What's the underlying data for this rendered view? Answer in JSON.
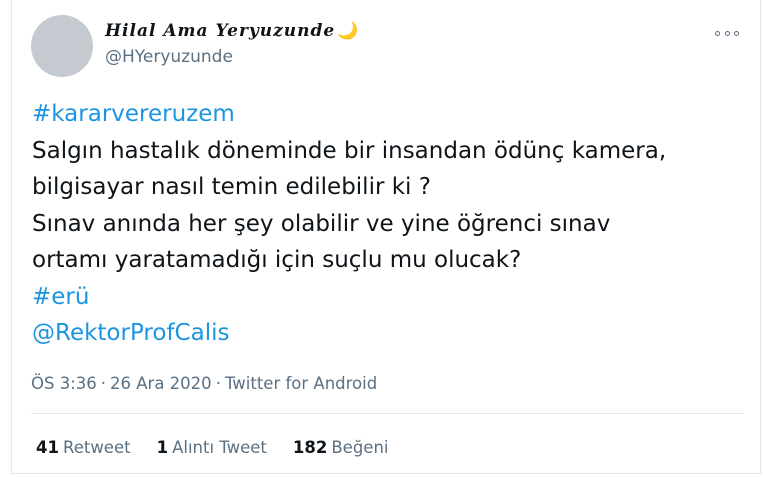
{
  "tweet": {
    "author": {
      "display_name": "Hilal Ama Yeryuzunde",
      "name_emoji": "🌙",
      "handle": "@HYeryuzunde"
    },
    "more_icon": "more-horizontal-icon",
    "lines": [
      {
        "text": "#kararvereruzem",
        "type": "hashtag"
      },
      {
        "text": "Salgın hastalık döneminde bir insandan ödünç kamera,",
        "type": "text"
      },
      {
        "text": "bilgisayar nasıl temin edilebilir ki ?",
        "type": "text"
      },
      {
        "text": "Sınav anında her şey olabilir ve yine öğrenci sınav",
        "type": "text"
      },
      {
        "text": "ortamı yaratamadığı için suçlu mu olucak?",
        "type": "text"
      },
      {
        "text": "#erü",
        "type": "hashtag"
      },
      {
        "text": "@RektorProfCalis",
        "type": "mention"
      }
    ],
    "meta": {
      "time": "ÖS 3:36",
      "date": "26 Ara 2020",
      "separator": "·",
      "source": "Twitter for Android"
    },
    "stats": {
      "retweets": {
        "count": "41",
        "label": "Retweet"
      },
      "quotes": {
        "count": "1",
        "label": "Alıntı Tweet"
      },
      "likes": {
        "count": "182",
        "label": "Beğeni"
      }
    }
  },
  "colors": {
    "link": "#1b95e0",
    "secondary_text": "#5b7083",
    "primary_text": "#0f1419",
    "border": "#e1e8ed"
  }
}
